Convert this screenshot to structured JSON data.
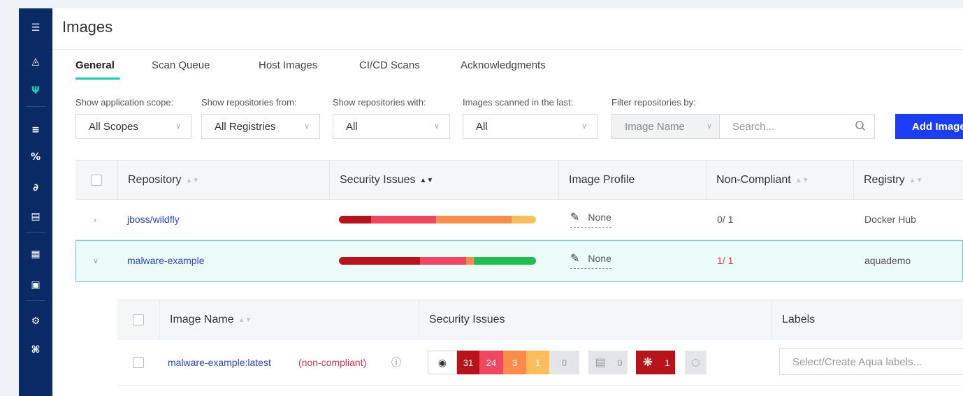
{
  "sidebar": {
    "icons": [
      "menu-icon",
      "dashboard-icon",
      "aqua-logo-icon",
      "layers-icon",
      "percent-icon",
      "functions-icon",
      "server-icon",
      "document-icon",
      "image-icon",
      "settings-icon",
      "network-icon"
    ]
  },
  "header": {
    "title": "Images"
  },
  "tabs": [
    {
      "label": "General",
      "active": true
    },
    {
      "label": "Scan Queue"
    },
    {
      "label": "Host Images"
    },
    {
      "label": "CI/CD Scans"
    },
    {
      "label": "Acknowledgments"
    }
  ],
  "filters": {
    "scope_label": "Show application scope:",
    "scope_value": "All Scopes",
    "repos_from_label": "Show repositories from:",
    "repos_from_value": "All Registries",
    "repos_with_label": "Show repositories with:",
    "repos_with_value": "All",
    "scanned_label": "Images scanned in the last:",
    "scanned_value": "All",
    "filter_by_label": "Filter repositories by:",
    "filter_by_value": "Image Name",
    "search_placeholder": "Search...",
    "add_button": "Add Images"
  },
  "table": {
    "columns": [
      "Repository",
      "Security Issues",
      "Image Profile",
      "Non-Compliant",
      "Registry"
    ],
    "rows": [
      {
        "name": "jboss/wildfly",
        "profile": "None",
        "non_compliant": "0/ 1",
        "registry": "Docker Hub",
        "expanded": false,
        "issues_bar": [
          {
            "color": "#b8121b",
            "weight": 12
          },
          {
            "color": "#f04660",
            "weight": 24
          },
          {
            "color": "#fa8c4b",
            "weight": 28
          },
          {
            "color": "#fcbd5a",
            "weight": 9
          }
        ]
      },
      {
        "name": "malware-example",
        "profile": "None",
        "non_compliant": "1/ 1",
        "registry": "aquademo",
        "expanded": true,
        "issues_bar": [
          {
            "color": "#b8121b",
            "weight": 30
          },
          {
            "color": "#f04660",
            "weight": 17
          },
          {
            "color": "#fa8c4b",
            "weight": 3
          },
          {
            "color": "#20bd50",
            "weight": 23
          }
        ]
      }
    ]
  },
  "subtable": {
    "columns": [
      "Image Name",
      "Security Issues",
      "Labels"
    ],
    "row": {
      "name": "malware-example:latest",
      "status": "(non-compliant)",
      "vuln_counts": {
        "critical": "31",
        "high": "24",
        "medium": "3",
        "low": "1",
        "negligible": "0"
      },
      "sensitive_data": "0",
      "malware": "1",
      "labels_placeholder": "Select/Create Aqua labels..."
    }
  },
  "colors": {
    "sidebar": "#0a2a66",
    "accent_teal": "#19d2b4",
    "primary_button": "#1c3cf5",
    "link": "#2c47c9",
    "critical": "#b8121b",
    "high": "#f04660",
    "medium": "#fa8c4b",
    "low": "#fcbd5a",
    "ok": "#20bd50"
  }
}
